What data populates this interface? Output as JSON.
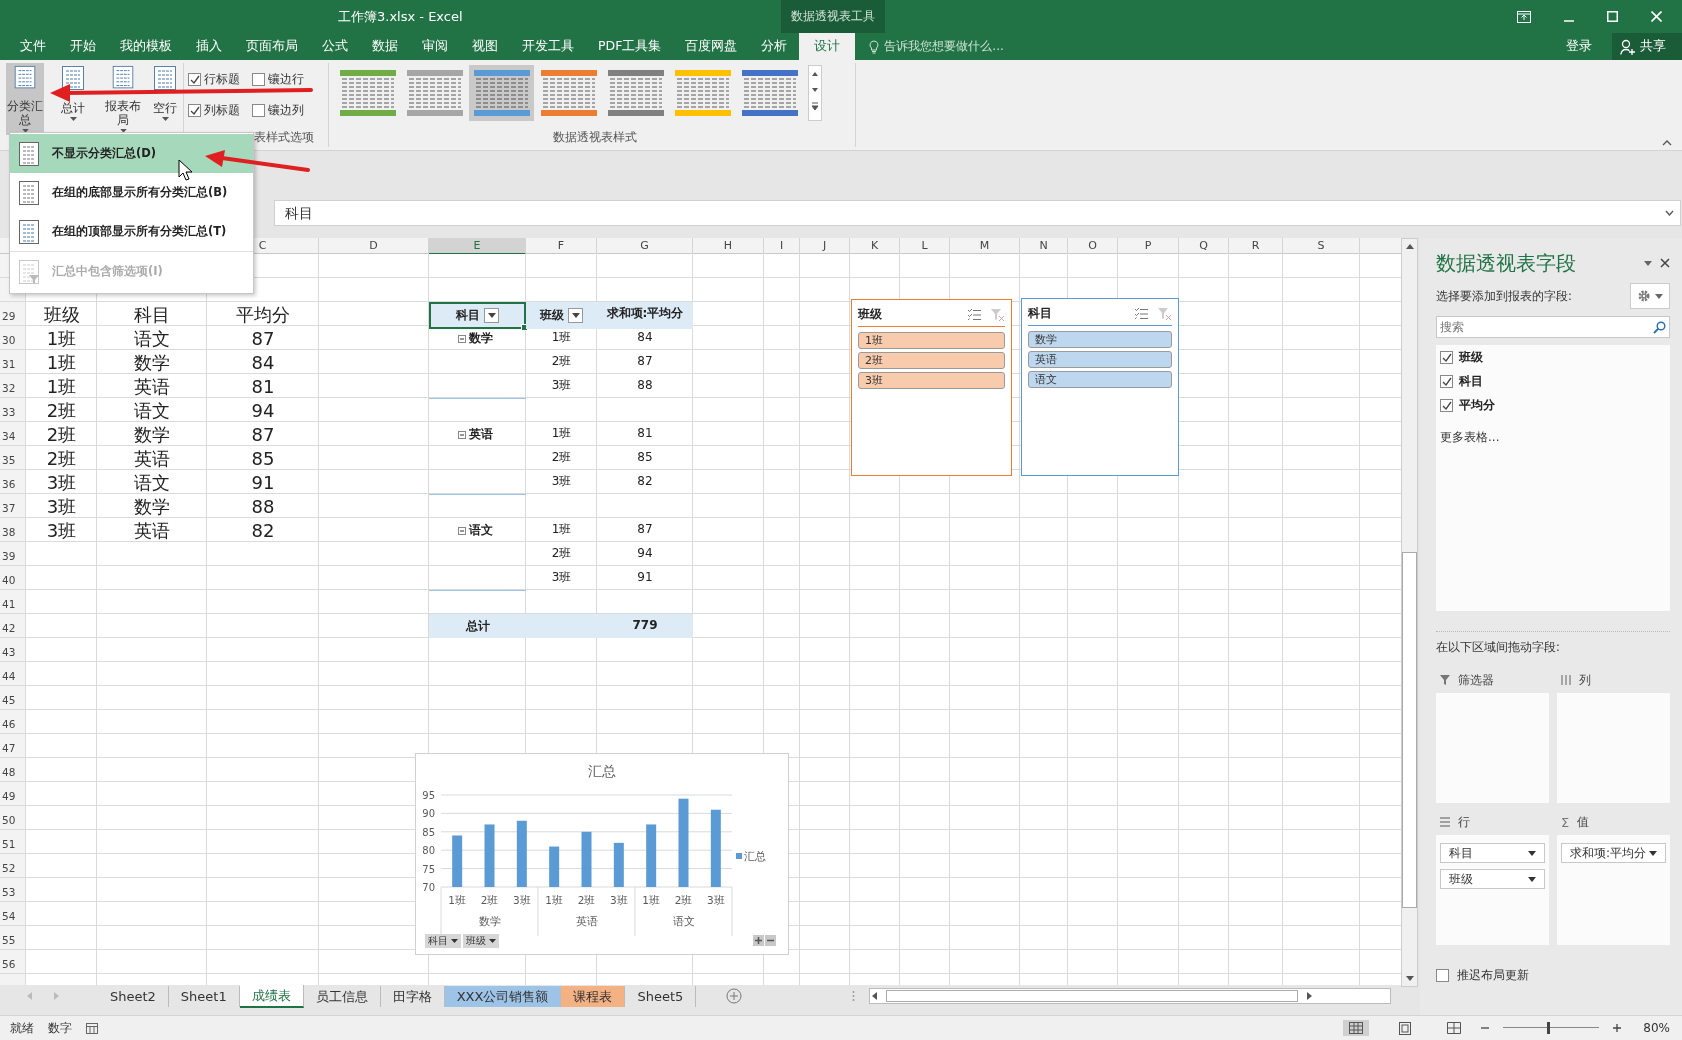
{
  "window": {
    "title": "工作簿3.xlsx - Excel",
    "context_group": "数据透视表工具"
  },
  "ribbon_tabs": [
    {
      "label": "文件",
      "selected": false
    },
    {
      "label": "开始",
      "selected": false
    },
    {
      "label": "我的模板",
      "selected": false
    },
    {
      "label": "插入",
      "selected": false
    },
    {
      "label": "页面布局",
      "selected": false
    },
    {
      "label": "公式",
      "selected": false
    },
    {
      "label": "数据",
      "selected": false
    },
    {
      "label": "审阅",
      "selected": false
    },
    {
      "label": "视图",
      "selected": false
    },
    {
      "label": "开发工具",
      "selected": false
    },
    {
      "label": "PDF工具集",
      "selected": false
    },
    {
      "label": "百度网盘",
      "selected": false
    },
    {
      "label": "分析",
      "selected": false
    },
    {
      "label": "设计",
      "selected": true
    }
  ],
  "tell_me": {
    "placeholder": "告诉我您想要做什么..."
  },
  "account": {
    "sign_in": "登录",
    "share": "共享"
  },
  "ribbon": {
    "layout_buttons": [
      {
        "label": "分类汇总",
        "pressed": true
      },
      {
        "label": "总计",
        "pressed": false
      },
      {
        "label": "报表布局",
        "pressed": false
      },
      {
        "label": "空行",
        "pressed": false
      }
    ],
    "style_options": [
      {
        "label": "行标题",
        "checked": true
      },
      {
        "label": "镶边行",
        "checked": false
      },
      {
        "label": "列标题",
        "checked": true
      },
      {
        "label": "镶边列",
        "checked": false
      }
    ],
    "style_options_group": "表样式选项",
    "styles": [
      {
        "color": "#70ad47",
        "selected": false
      },
      {
        "color": "#a6a6a6",
        "selected": false
      },
      {
        "color": "#5b9bd5",
        "selected": true
      },
      {
        "color": "#ed7d31",
        "selected": false
      },
      {
        "color": "#808080",
        "selected": false
      },
      {
        "color": "#ffc000",
        "selected": false
      },
      {
        "color": "#4472c4",
        "selected": false
      }
    ],
    "styles_group": "数据透视表样式"
  },
  "subtotal_menu": {
    "items": [
      {
        "label": "不显示分类汇总(D)",
        "selected": true,
        "disabled": false
      },
      {
        "label": "在组的底部显示所有分类汇总(B)",
        "selected": false,
        "disabled": false
      },
      {
        "label": "在组的顶部显示所有分类汇总(T)",
        "selected": false,
        "disabled": false
      },
      {
        "label": "汇总中包含筛选项(I)",
        "selected": false,
        "disabled": true
      }
    ]
  },
  "formula_bar": {
    "value": "科目"
  },
  "sheet": {
    "column_headers": [
      {
        "label": "C",
        "selected": false
      },
      {
        "label": "D",
        "selected": false
      },
      {
        "label": "E",
        "selected": true
      },
      {
        "label": "F",
        "selected": false
      },
      {
        "label": "G",
        "selected": false
      },
      {
        "label": "H",
        "selected": false
      },
      {
        "label": "I",
        "selected": false
      },
      {
        "label": "J",
        "selected": false
      },
      {
        "label": "K",
        "selected": false
      },
      {
        "label": "L",
        "selected": false
      },
      {
        "label": "M",
        "selected": false
      },
      {
        "label": "N",
        "selected": false
      },
      {
        "label": "O",
        "selected": false
      },
      {
        "label": "P",
        "selected": false
      },
      {
        "label": "Q",
        "selected": false
      },
      {
        "label": "R",
        "selected": false
      },
      {
        "label": "S",
        "selected": false
      }
    ],
    "rows": [
      {
        "num": "29",
        "data": [
          "班级",
          "科目",
          "平均分"
        ],
        "pivot": {
          "kind": "header",
          "cells": [
            "科目",
            "班级",
            "求和项:平均分"
          ]
        }
      },
      {
        "num": "30",
        "data": [
          "1班",
          "语文",
          "87"
        ],
        "pivot": {
          "kind": "group",
          "expanded": true,
          "cells": [
            "数学",
            "1班",
            "84"
          ]
        }
      },
      {
        "num": "31",
        "data": [
          "1班",
          "数学",
          "84"
        ],
        "pivot": {
          "kind": "item",
          "cells": [
            "2班",
            "87"
          ]
        }
      },
      {
        "num": "32",
        "data": [
          "1班",
          "英语",
          "81"
        ],
        "pivot": {
          "kind": "item",
          "cells": [
            "3班",
            "88"
          ]
        }
      },
      {
        "num": "33",
        "data": [
          "2班",
          "语文",
          "94"
        ],
        "pivot": {
          "kind": "blank"
        }
      },
      {
        "num": "34",
        "data": [
          "2班",
          "数学",
          "87"
        ],
        "pivot": {
          "kind": "group",
          "expanded": true,
          "cells": [
            "英语",
            "1班",
            "81"
          ]
        }
      },
      {
        "num": "35",
        "data": [
          "2班",
          "英语",
          "85"
        ],
        "pivot": {
          "kind": "item",
          "cells": [
            "2班",
            "85"
          ]
        }
      },
      {
        "num": "36",
        "data": [
          "3班",
          "语文",
          "91"
        ],
        "pivot": {
          "kind": "item",
          "cells": [
            "3班",
            "82"
          ]
        }
      },
      {
        "num": "37",
        "data": [
          "3班",
          "数学",
          "88"
        ],
        "pivot": {
          "kind": "blank"
        }
      },
      {
        "num": "38",
        "data": [
          "3班",
          "英语",
          "82"
        ],
        "pivot": {
          "kind": "group",
          "expanded": true,
          "cells": [
            "语文",
            "1班",
            "87"
          ]
        }
      },
      {
        "num": "39",
        "pivot": {
          "kind": "item",
          "cells": [
            "2班",
            "94"
          ]
        }
      },
      {
        "num": "40",
        "pivot": {
          "kind": "item",
          "cells": [
            "3班",
            "91"
          ]
        }
      },
      {
        "num": "41",
        "pivot": {
          "kind": "blank"
        }
      },
      {
        "num": "42",
        "pivot": {
          "kind": "total",
          "cells": [
            "总计",
            "779"
          ]
        }
      },
      {
        "num": "43"
      },
      {
        "num": "44"
      },
      {
        "num": "45"
      },
      {
        "num": "46"
      },
      {
        "num": "47"
      },
      {
        "num": "48"
      },
      {
        "num": "49"
      },
      {
        "num": "50"
      },
      {
        "num": "51"
      },
      {
        "num": "52"
      },
      {
        "num": "53"
      },
      {
        "num": "54"
      },
      {
        "num": "55"
      },
      {
        "num": "56"
      }
    ]
  },
  "slicers": [
    {
      "title": "班级",
      "color": "#ed7d31",
      "items": [
        {
          "label": "1班",
          "selected": true
        },
        {
          "label": "2班",
          "selected": true
        },
        {
          "label": "3班",
          "selected": true
        }
      ]
    },
    {
      "title": "科目",
      "color": "#5b9bd5",
      "items": [
        {
          "label": "数学",
          "selected": true
        },
        {
          "label": "英语",
          "selected": true
        },
        {
          "label": "语文",
          "selected": true
        }
      ]
    }
  ],
  "chart": {
    "chart_data": {
      "type": "bar",
      "title": "汇总",
      "categories": [
        "1班",
        "2班",
        "3班",
        "1班",
        "2班",
        "3班",
        "1班",
        "2班",
        "3班"
      ],
      "grid": true,
      "series": [
        {
          "name": "汇总",
          "color": "#5b9bd5",
          "values": [
            84,
            87,
            88,
            81,
            85,
            82,
            87,
            94,
            91
          ]
        }
      ],
      "ylim": [
        70,
        95
      ],
      "yticks": [
        70,
        75,
        80,
        85,
        90,
        95
      ]
    },
    "axis_groups": [
      "数学",
      "英语",
      "语文"
    ],
    "field_buttons": [
      "科目",
      "班级"
    ]
  },
  "field_pane": {
    "title": "数据透视表字段",
    "prompt": "选择要添加到报表的字段:",
    "search": {
      "placeholder": "搜索"
    },
    "fields": [
      {
        "label": "班级",
        "checked": true
      },
      {
        "label": "科目",
        "checked": true
      },
      {
        "label": "平均分",
        "checked": true
      }
    ],
    "more_tables": "更多表格...",
    "areas_prompt": "在以下区域间拖动字段:",
    "areas": [
      {
        "kind": "filters",
        "label": "筛选器"
      },
      {
        "kind": "columns",
        "label": "列"
      },
      {
        "kind": "rows",
        "label": "行",
        "items": [
          "科目",
          "班级"
        ]
      },
      {
        "kind": "values",
        "label": "值",
        "symbol": "Σ",
        "items": [
          "求和项:平均分"
        ]
      }
    ],
    "defer_update": {
      "label": "推迟布局更新",
      "checked": false
    }
  },
  "sheet_tabs": [
    {
      "label": "Sheet2",
      "selected": false
    },
    {
      "label": "Sheet1",
      "selected": false
    },
    {
      "label": "成绩表",
      "selected": true
    },
    {
      "label": "员工信息",
      "selected": false
    },
    {
      "label": "田字格",
      "selected": false
    },
    {
      "label": "XXX公司销售额",
      "selected": false,
      "color": "#9dc3e6"
    },
    {
      "label": "课程表",
      "selected": false,
      "color": "#f4b183"
    },
    {
      "label": "Sheet5",
      "selected": false
    }
  ],
  "status_bar": {
    "ready": "就绪",
    "mode": "数字",
    "zoom": "80%",
    "zoom_slider": {
      "level": 0.45
    }
  }
}
